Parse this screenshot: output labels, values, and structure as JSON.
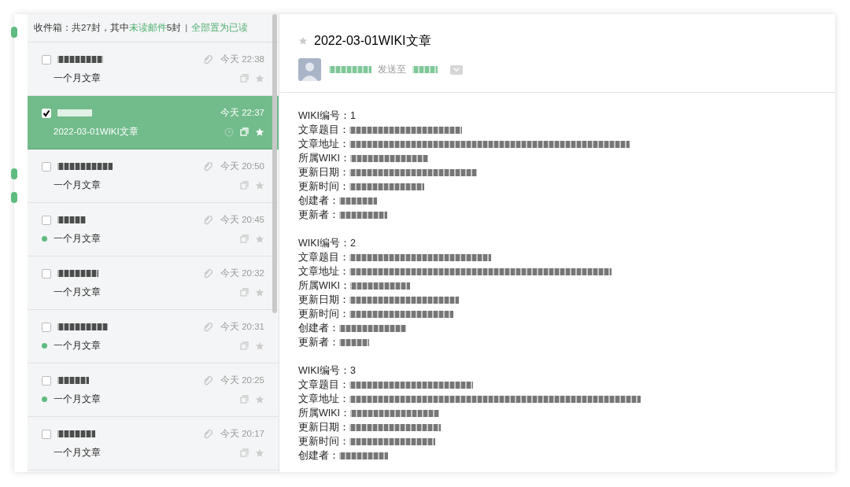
{
  "inbox_header": {
    "prefix": "收件箱：共27封，其中",
    "unread_link": "未读邮件",
    "suffix": "5封",
    "separator": "|",
    "mark_all_read": "全部置为已读"
  },
  "side_markers": [
    {
      "kind": "pill"
    },
    {
      "kind": "pill"
    },
    {
      "kind": "pill"
    }
  ],
  "mails": [
    {
      "time": "今天 22:38",
      "subject": "一个月文章",
      "selected": false,
      "checked": false,
      "unread": false,
      "attachment": true,
      "starred": false
    },
    {
      "time": "今天 22:37",
      "subject": "2022-03-01WIKI文章",
      "selected": true,
      "checked": true,
      "unread": false,
      "attachment": false,
      "starred": false
    },
    {
      "time": "今天 20:50",
      "subject": "一个月文章",
      "selected": false,
      "checked": false,
      "unread": false,
      "attachment": true,
      "starred": false
    },
    {
      "time": "今天 20:45",
      "subject": "一个月文章",
      "selected": false,
      "checked": false,
      "unread": true,
      "attachment": true,
      "starred": false
    },
    {
      "time": "今天 20:32",
      "subject": "一个月文章",
      "selected": false,
      "checked": false,
      "unread": false,
      "attachment": true,
      "starred": false
    },
    {
      "time": "今天 20:31",
      "subject": "一个月文章",
      "selected": false,
      "checked": false,
      "unread": true,
      "attachment": true,
      "starred": false
    },
    {
      "time": "今天 20:25",
      "subject": "一个月文章",
      "selected": false,
      "checked": false,
      "unread": true,
      "attachment": true,
      "starred": false
    },
    {
      "time": "今天 20:17",
      "subject": "一个月文章",
      "selected": false,
      "checked": false,
      "unread": false,
      "attachment": true,
      "starred": false
    }
  ],
  "message": {
    "title": "2022-03-01WIKI文章",
    "starred": false,
    "sent_to": "发送至",
    "entries": [
      {
        "lines": [
          {
            "label": "WIKI编号：",
            "value": "1"
          },
          {
            "label": "文章题目："
          },
          {
            "label": "文章地址："
          },
          {
            "label": "所属WIKI："
          },
          {
            "label": "更新日期："
          },
          {
            "label": "更新时间："
          },
          {
            "label": "创建者："
          },
          {
            "label": "更新者："
          }
        ]
      },
      {
        "lines": [
          {
            "label": "WIKI编号：",
            "value": "2"
          },
          {
            "label": "文章题目："
          },
          {
            "label": "文章地址："
          },
          {
            "label": "所属WIKI："
          },
          {
            "label": "更新日期："
          },
          {
            "label": "更新时间："
          },
          {
            "label": "创建者："
          },
          {
            "label": "更新者："
          }
        ]
      },
      {
        "lines": [
          {
            "label": "WIKI编号：",
            "value": "3"
          },
          {
            "label": "文章题目："
          },
          {
            "label": "文章地址："
          },
          {
            "label": "所属WIKI："
          },
          {
            "label": "更新日期："
          },
          {
            "label": "更新时间："
          },
          {
            "label": "创建者："
          }
        ]
      }
    ]
  }
}
